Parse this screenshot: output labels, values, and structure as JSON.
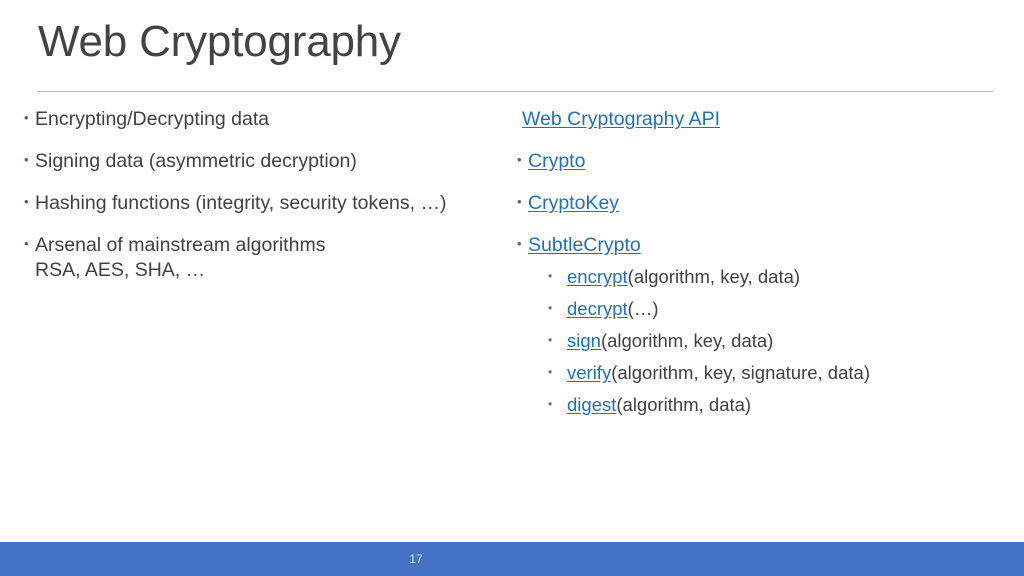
{
  "slide": {
    "title": "Web Cryptography",
    "page_number": "17",
    "accent_color": "#4472c4",
    "link_color": "#1f6fc0",
    "text_color": "#404040",
    "bullet_color": "#4a5e8f"
  },
  "left_column": {
    "items": [
      {
        "text": "Encrypting/Decrypting data"
      },
      {
        "text": "Signing data (asymmetric decryption)"
      },
      {
        "text": "Hashing functions (integrity, security tokens, …)"
      },
      {
        "text": "Arsenal of mainstream algorithms",
        "second_line": "RSA, AES, SHA, …"
      }
    ]
  },
  "right_column": {
    "heading_link": "Web Cryptography API",
    "items": [
      {
        "link": "Crypto"
      },
      {
        "link": "CryptoKey"
      },
      {
        "link": "SubtleCrypto"
      }
    ],
    "methods": [
      {
        "link": "encrypt",
        "args": "(algorithm, key, data)"
      },
      {
        "link": "decrypt",
        "args": "(…)"
      },
      {
        "link": "sign",
        "args": "(algorithm, key, data)"
      },
      {
        "link": "verify",
        "args": "(algorithm, key, signature, data)"
      },
      {
        "link": "digest",
        "args": "(algorithm, data)"
      }
    ]
  }
}
